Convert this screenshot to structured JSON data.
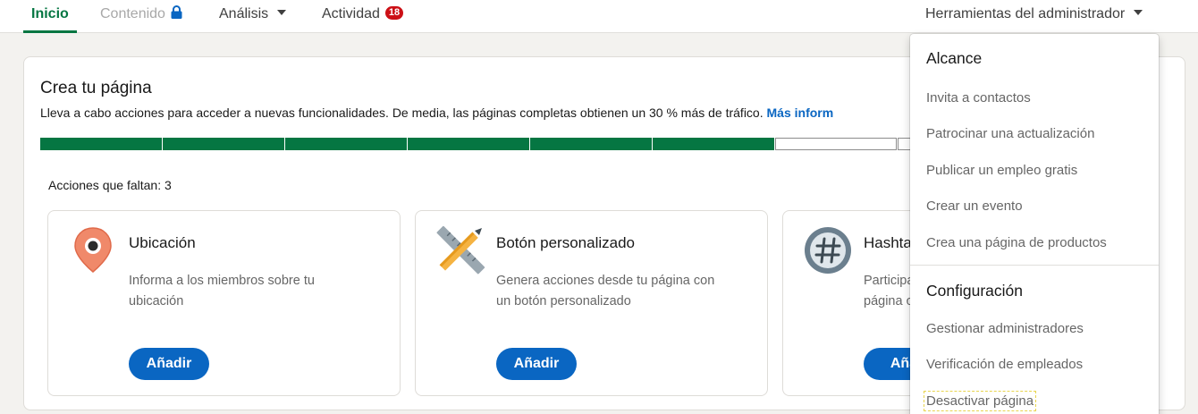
{
  "nav": {
    "tabs": [
      {
        "label": "Inicio",
        "active": true
      },
      {
        "label": "Contenido",
        "locked": true
      },
      {
        "label": "Análisis",
        "has_dropdown": true
      },
      {
        "label": "Actividad",
        "badge": "18"
      }
    ],
    "admin_tools": "Herramientas del administrador"
  },
  "page_card": {
    "title": "Crea tu página",
    "subtitle": "Lleva a cabo acciones para acceder a nuevas funcionalidades. De media, las páginas completas obtienen un 30 % más de tráfico.",
    "more_link": "Más inform",
    "progress": {
      "completed_steps": 6,
      "total_steps": 9
    },
    "missing_actions": "Acciones que faltan: 3",
    "actions": [
      {
        "title": "Ubicación",
        "description": "Informa a los miembros sobre tu ubicación",
        "button": "Añadir",
        "icon": "location-pin-icon"
      },
      {
        "title": "Botón personalizado",
        "description": "Genera acciones desde tu página con un botón personalizado",
        "button": "Añadir",
        "icon": "pencil-ruler-icon"
      },
      {
        "title": "Hashta",
        "description": "Participa página o",
        "button": "Aña",
        "icon": "hashtag-icon"
      }
    ]
  },
  "admin_menu": {
    "sections": [
      {
        "heading": "Alcance",
        "items": [
          "Invita a contactos",
          "Patrocinar una actualización",
          "Publicar un empleo gratis",
          "Crear un evento",
          "Crea una página de productos"
        ]
      },
      {
        "heading": "Configuración",
        "items": [
          "Gestionar administradores",
          "Verificación de empleados",
          "Desactivar página"
        ]
      }
    ]
  },
  "colors": {
    "accent_green": "#057642",
    "primary_blue": "#0a66c2",
    "badge_red": "#cc1016"
  }
}
